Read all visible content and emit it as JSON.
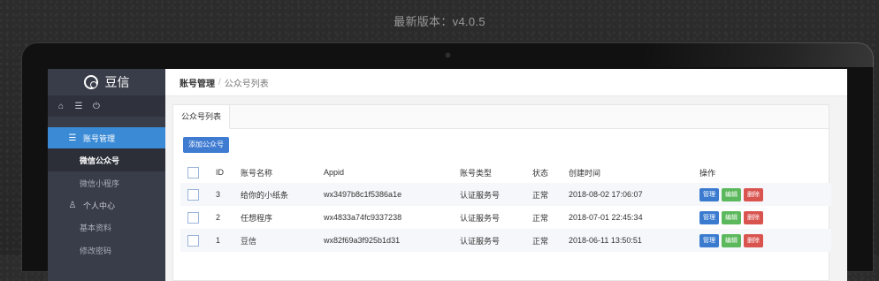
{
  "version_text": "最新版本：v4.0.5",
  "sidebar": {
    "brand": "豆信",
    "tools": [
      "⌂",
      "☰",
      "⏻"
    ],
    "menu": [
      {
        "type": "parent",
        "icon": "☰",
        "label": "账号管理",
        "active": true
      },
      {
        "type": "child",
        "label": "微信公众号",
        "active": true
      },
      {
        "type": "child",
        "label": "微信小程序",
        "active": false
      },
      {
        "type": "parent",
        "icon": "♙",
        "label": "个人中心",
        "active": false
      },
      {
        "type": "child",
        "label": "基本资料",
        "active": false
      },
      {
        "type": "child",
        "label": "修改密码",
        "active": false
      }
    ]
  },
  "breadcrumb": {
    "parent": "账号管理",
    "separator": "/",
    "current": "公众号列表"
  },
  "tab": {
    "label": "公众号列表"
  },
  "add_button": "添加公众号",
  "table": {
    "headers": [
      "ID",
      "账号名称",
      "Appid",
      "账号类型",
      "状态",
      "创建时间",
      "操作"
    ],
    "actions": {
      "manage": "管理",
      "edit": "编辑",
      "delete": "删除"
    },
    "rows": [
      {
        "id": "3",
        "name": "给你的小纸条",
        "appid": "wx3497b8c1f5386a1e",
        "type": "认证服务号",
        "status": "正常",
        "created": "2018-08-02 17:06:07"
      },
      {
        "id": "2",
        "name": "任想程序",
        "appid": "wx4833a74fc9337238",
        "type": "认证服务号",
        "status": "正常",
        "created": "2018-07-01 22:45:34"
      },
      {
        "id": "1",
        "name": "豆信",
        "appid": "wx82f69a3f925b1d31",
        "type": "认证服务号",
        "status": "正常",
        "created": "2018-06-11 13:50:51"
      }
    ]
  },
  "colors": {
    "primary": "#3e7bd1",
    "success": "#5cb85c",
    "danger": "#d9534f",
    "sidebar": "#393d49"
  }
}
